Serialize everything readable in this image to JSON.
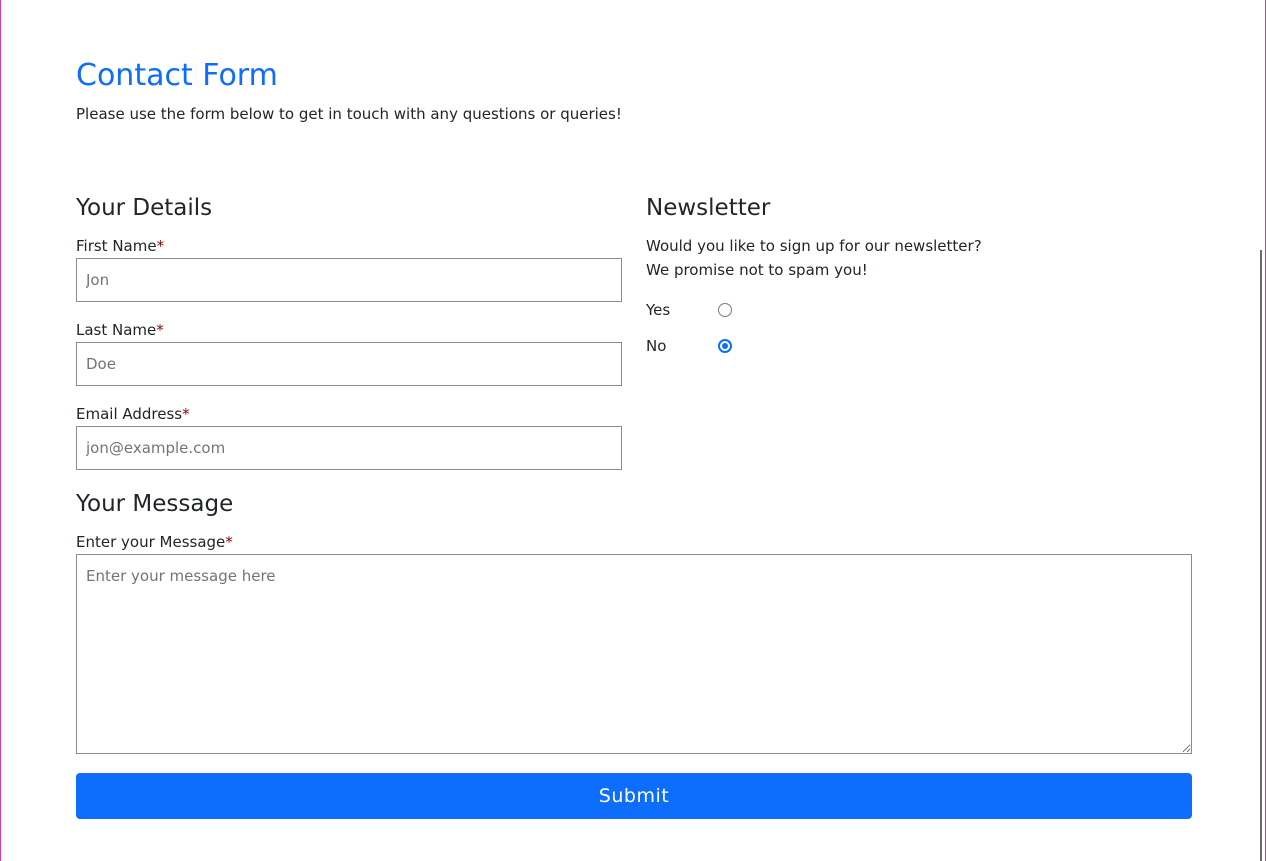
{
  "header": {
    "title": "Contact Form",
    "subtitle": "Please use the form below to get in touch with any questions or queries!"
  },
  "details": {
    "heading": "Your Details",
    "first_name": {
      "label": "First Name",
      "required_mark": "*",
      "placeholder": "Jon",
      "value": ""
    },
    "last_name": {
      "label": "Last Name",
      "required_mark": "*",
      "placeholder": "Doe",
      "value": ""
    },
    "email": {
      "label": "Email Address",
      "required_mark": "*",
      "placeholder": "jon@example.com",
      "value": ""
    }
  },
  "newsletter": {
    "heading": "Newsletter",
    "question": "Would you like to sign up for our newsletter?",
    "note": "We promise not to spam you!",
    "options": [
      {
        "label": "Yes",
        "checked": false
      },
      {
        "label": "No",
        "checked": true
      }
    ]
  },
  "message": {
    "heading": "Your Message",
    "label": "Enter your Message",
    "required_mark": "*",
    "placeholder": "Enter your message here",
    "value": ""
  },
  "submit": {
    "label": "Submit"
  },
  "colors": {
    "accent": "#0d6efd",
    "required": "#8b0000",
    "page_border": "#d63a9a"
  }
}
